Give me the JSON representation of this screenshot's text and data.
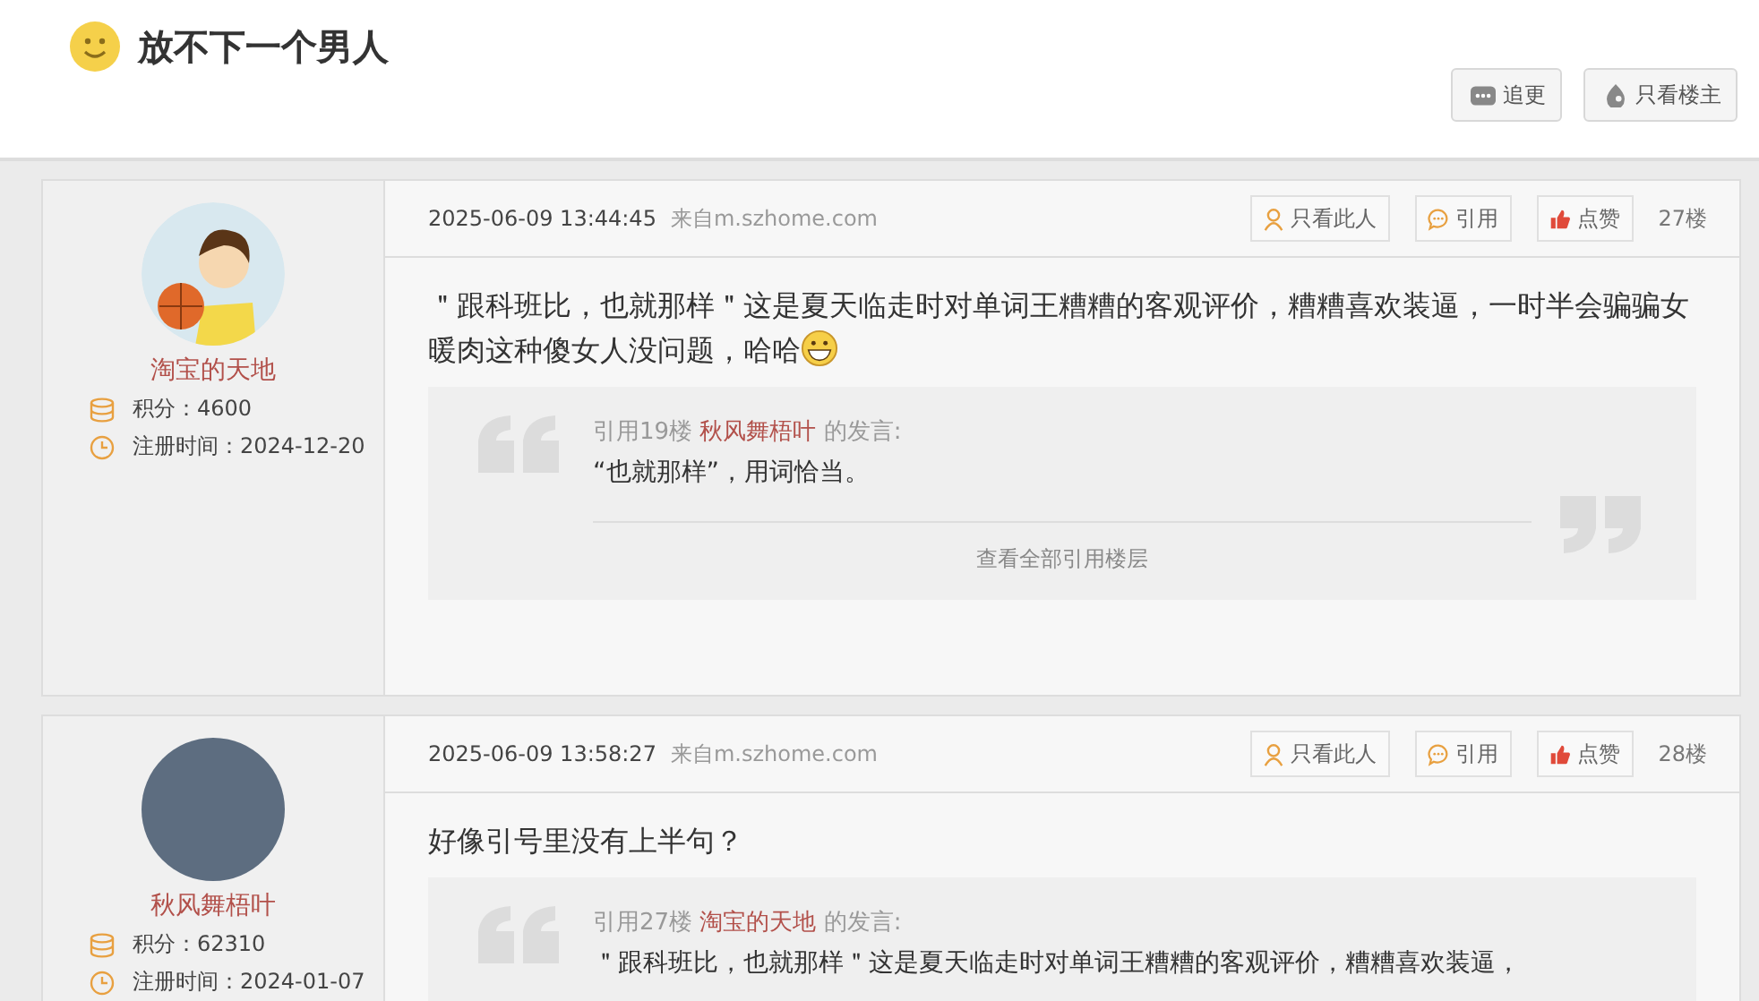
{
  "topic": {
    "title": "放不下一个男人"
  },
  "header_buttons": [
    {
      "label": "追更",
      "kind": "follow"
    },
    {
      "label": "只看楼主",
      "kind": "op"
    }
  ],
  "posts": [
    {
      "user": {
        "name": "淘宝的天地",
        "avatar": {
          "kind": "cartoon"
        },
        "points": "积分：4600",
        "registered": "注册时间：2024-12-20"
      },
      "time": "2025-06-09 13:44:45",
      "source": "来自m.szhome.com",
      "actions": [
        {
          "label": "只看此人",
          "kind": "person"
        },
        {
          "label": "引用",
          "kind": "quote"
        },
        {
          "label": "点赞",
          "kind": "like"
        }
      ],
      "floor": "27楼",
      "body": "＂跟科班比，也就那样＂这是夏天临走时对单词王糟糟的客观评价，糟糟喜欢装逼，一时半会骗骗女暖肉这种傻女人没问题，哈哈",
      "emoji": {
        "kind": "grin"
      },
      "quote": {
        "prefix": "引用19楼",
        "author": "秋风舞梧叶",
        "suffix": "的发言:",
        "text": "“也就那样”，用词恰当。",
        "more": "查看全部引用楼层"
      }
    },
    {
      "user": {
        "name": "秋风舞梧叶",
        "avatar": {
          "kind": "photo"
        },
        "points": "积分：62310",
        "registered": "注册时间：2024-01-07"
      },
      "time": "2025-06-09 13:58:27",
      "source": "来自m.szhome.com",
      "actions": [
        {
          "label": "只看此人",
          "kind": "person"
        },
        {
          "label": "引用",
          "kind": "quote"
        },
        {
          "label": "点赞",
          "kind": "like"
        }
      ],
      "floor": "28楼",
      "body": "好像引号里没有上半句？",
      "quote": {
        "prefix": "引用27楼",
        "author": "淘宝的天地",
        "suffix": "的发言:",
        "text": "＂跟科班比，也就那样＂这是夏天临走时对单词王糟糟的客观评价，糟糟喜欢装逼，"
      }
    }
  ]
}
